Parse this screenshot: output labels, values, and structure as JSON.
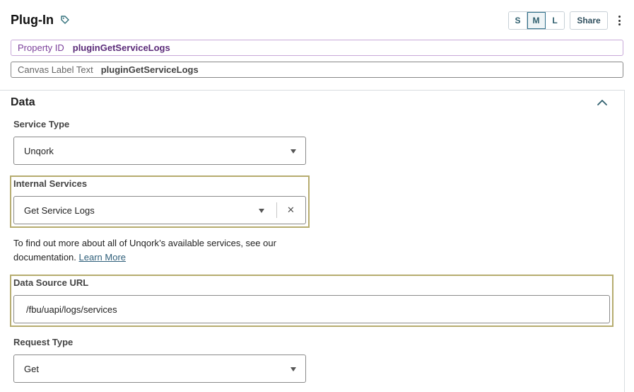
{
  "header": {
    "title": "Plug-In",
    "tag_icon": "tag-icon",
    "sizes": [
      "S",
      "M",
      "L"
    ],
    "active_size": "M",
    "share_label": "Share",
    "more_icon": "kebab-icon"
  },
  "properties": {
    "property_id_label": "Property ID",
    "property_id_value": "pluginGetServiceLogs",
    "canvas_label": "Canvas Label Text",
    "canvas_value": "pluginGetServiceLogs"
  },
  "section": {
    "title": "Data",
    "collapse_icon": "chevron-up-icon"
  },
  "fields": {
    "service_type": {
      "label": "Service Type",
      "value": "Unqork"
    },
    "internal_services": {
      "label": "Internal Services",
      "value": "Get Service Logs"
    },
    "help_text": "To find out more about all of Unqork’s available services, see our documentation.",
    "help_link": "Learn More",
    "data_source_url": {
      "label": "Data Source URL",
      "value": "/fbu/uapi/logs/services"
    },
    "request_type": {
      "label": "Request Type",
      "value": "Get"
    }
  }
}
